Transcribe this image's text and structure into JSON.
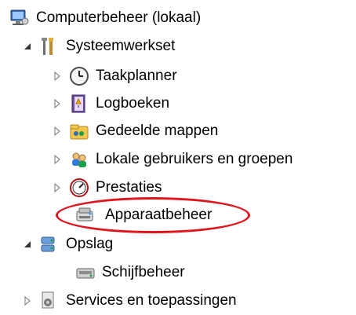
{
  "tree": {
    "root": {
      "label": "Computerbeheer (lokaal)",
      "icon": "computer-management-icon"
    },
    "system_tools": {
      "label": "Systeemwerkset",
      "icon": "tools-icon",
      "children": [
        {
          "label": "Taakplanner",
          "icon": "clock-icon"
        },
        {
          "label": "Logboeken",
          "icon": "event-viewer-icon"
        },
        {
          "label": "Gedeelde mappen",
          "icon": "shared-folders-icon"
        },
        {
          "label": "Lokale gebruikers en groepen",
          "icon": "users-icon"
        },
        {
          "label": "Prestaties",
          "icon": "performance-icon"
        },
        {
          "label": "Apparaatbeheer",
          "icon": "device-manager-icon"
        }
      ]
    },
    "storage": {
      "label": "Opslag",
      "icon": "storage-icon",
      "children": [
        {
          "label": "Schijfbeheer",
          "icon": "disk-management-icon"
        }
      ]
    },
    "services": {
      "label": "Services en toepassingen",
      "icon": "services-icon"
    }
  },
  "highlight_color": "#e2141b"
}
